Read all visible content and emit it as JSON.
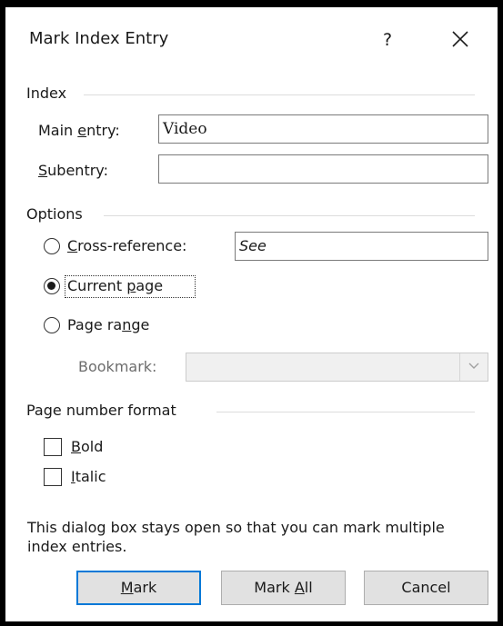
{
  "dialog": {
    "title": "Mark Index Entry",
    "help_symbol": "?",
    "close_icon": "close-icon"
  },
  "index": {
    "group_title": "Index",
    "main_entry": {
      "label_pre": "Main ",
      "label_key": "e",
      "label_post": "ntry:",
      "value": "Video"
    },
    "subentry": {
      "label_pre": "",
      "label_key": "S",
      "label_post": "ubentry:",
      "value": ""
    }
  },
  "options": {
    "group_title": "Options",
    "cross_reference": {
      "label_pre": "",
      "label_key": "C",
      "label_post": "ross-reference:",
      "value": "See",
      "checked": false
    },
    "current_page": {
      "label_pre": "Current ",
      "label_key": "p",
      "label_post": "age",
      "checked": true
    },
    "page_range": {
      "label_pre": "Page ra",
      "label_key": "n",
      "label_post": "ge",
      "checked": false
    },
    "bookmark": {
      "label": "Bookmark:",
      "value": "",
      "enabled": false
    }
  },
  "page_number_format": {
    "group_title": "Page number format",
    "bold": {
      "label_key": "B",
      "label_post": "old",
      "checked": false
    },
    "italic": {
      "label_key": "I",
      "label_post": "talic",
      "checked": false
    }
  },
  "note": "This dialog box stays open so that you can mark multiple index entries.",
  "buttons": {
    "mark": {
      "label_key": "M",
      "label_post": "ark"
    },
    "mark_all": {
      "label_pre": "Mark ",
      "label_key": "A",
      "label_post": "ll"
    },
    "cancel": {
      "label": "Cancel"
    }
  },
  "colors": {
    "accent": "#0078d7",
    "button_bg": "#e1e1e1",
    "frame": "#000000"
  }
}
